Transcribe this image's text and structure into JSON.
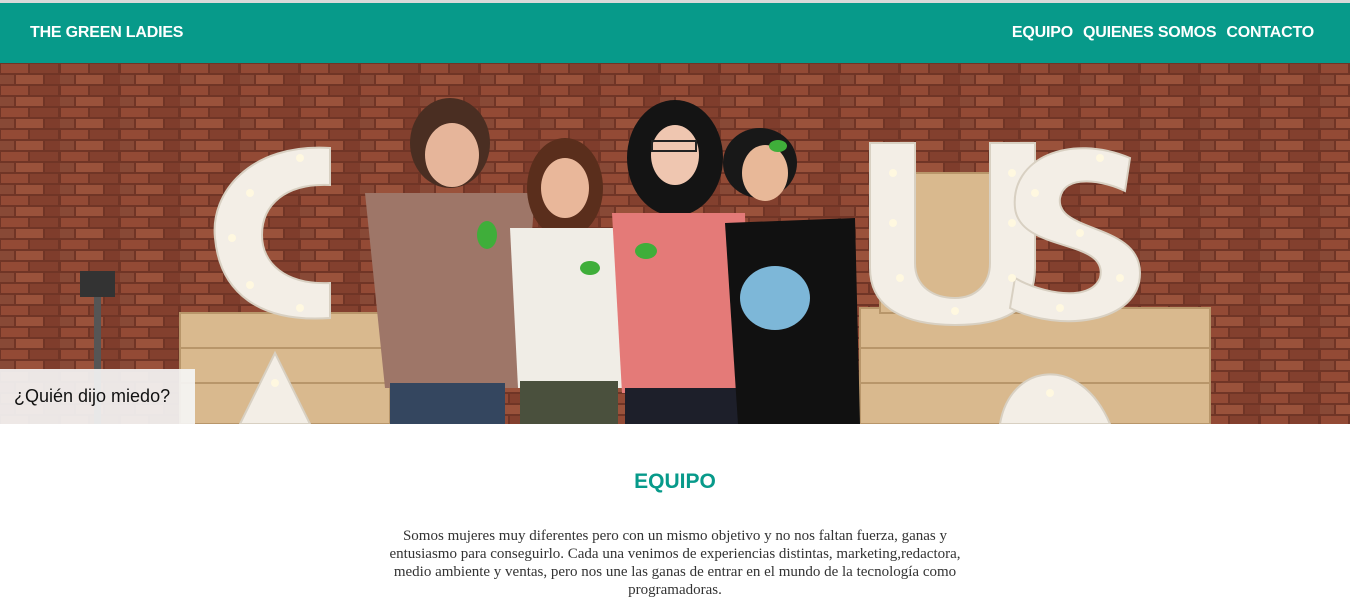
{
  "nav": {
    "brand": "THE GREEN LADIES",
    "links": [
      "EQUIPO",
      "QUIENES SOMOS",
      "CONTACTO"
    ]
  },
  "hero": {
    "caption": "¿Quién dijo miedo?"
  },
  "section": {
    "title": "EQUIPO",
    "text": "Somos mujeres muy diferentes pero con un mismo objetivo y no nos faltan fuerza, ganas y entusiasmo para conseguirlo. Cada una venimos de experiencias distintas, marketing,redactora, medio ambiente y ventas, pero nos une las ganas de entrar en el mundo de la tecnología como programadoras."
  },
  "colors": {
    "brand": "#079a8a",
    "text": "#333333"
  }
}
